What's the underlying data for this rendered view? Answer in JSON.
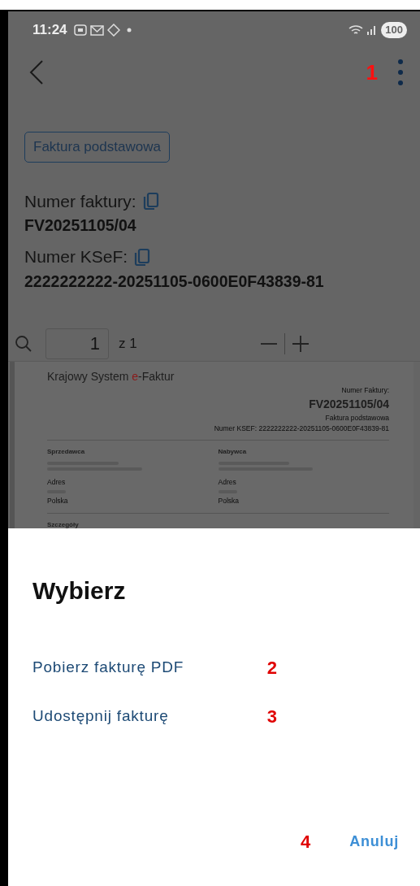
{
  "status_bar": {
    "time": "11:24",
    "battery": "100"
  },
  "toolbar": {
    "annotation": "1"
  },
  "invoice": {
    "type_chip": "Faktura podstawowa",
    "number_label": "Numer faktury:",
    "number": "FV20251105/04",
    "ksef_label": "Numer KSeF:",
    "ksef_number": "2222222222-20251105-0600E0F43839-81"
  },
  "pdf_toolbar": {
    "page": "1",
    "page_total": "z 1"
  },
  "pdf_page": {
    "brand_before": "Krajowy System ",
    "brand_accent": "e",
    "brand_after": "-Faktur",
    "number_label": "Numer Faktury:",
    "number": "FV20251105/04",
    "type": "Faktura podstawowa",
    "ksef": "Numer KSEF: 2222222222-20251105-0600E0F43839-81",
    "parties": [
      {
        "heading": "Sprzedawca",
        "address_label": "Adres",
        "country": "Polska"
      },
      {
        "heading": "Nabywca",
        "address_label": "Adres",
        "country": "Polska"
      }
    ],
    "details_heading": "Szczegóły"
  },
  "sheet": {
    "title": "Wybierz",
    "options": [
      {
        "label": "Pobierz fakturę PDF",
        "annotation": "2"
      },
      {
        "label": "Udostępnij fakturę",
        "annotation": "3"
      }
    ],
    "cancel": {
      "label": "Anuluj",
      "annotation": "4"
    }
  }
}
